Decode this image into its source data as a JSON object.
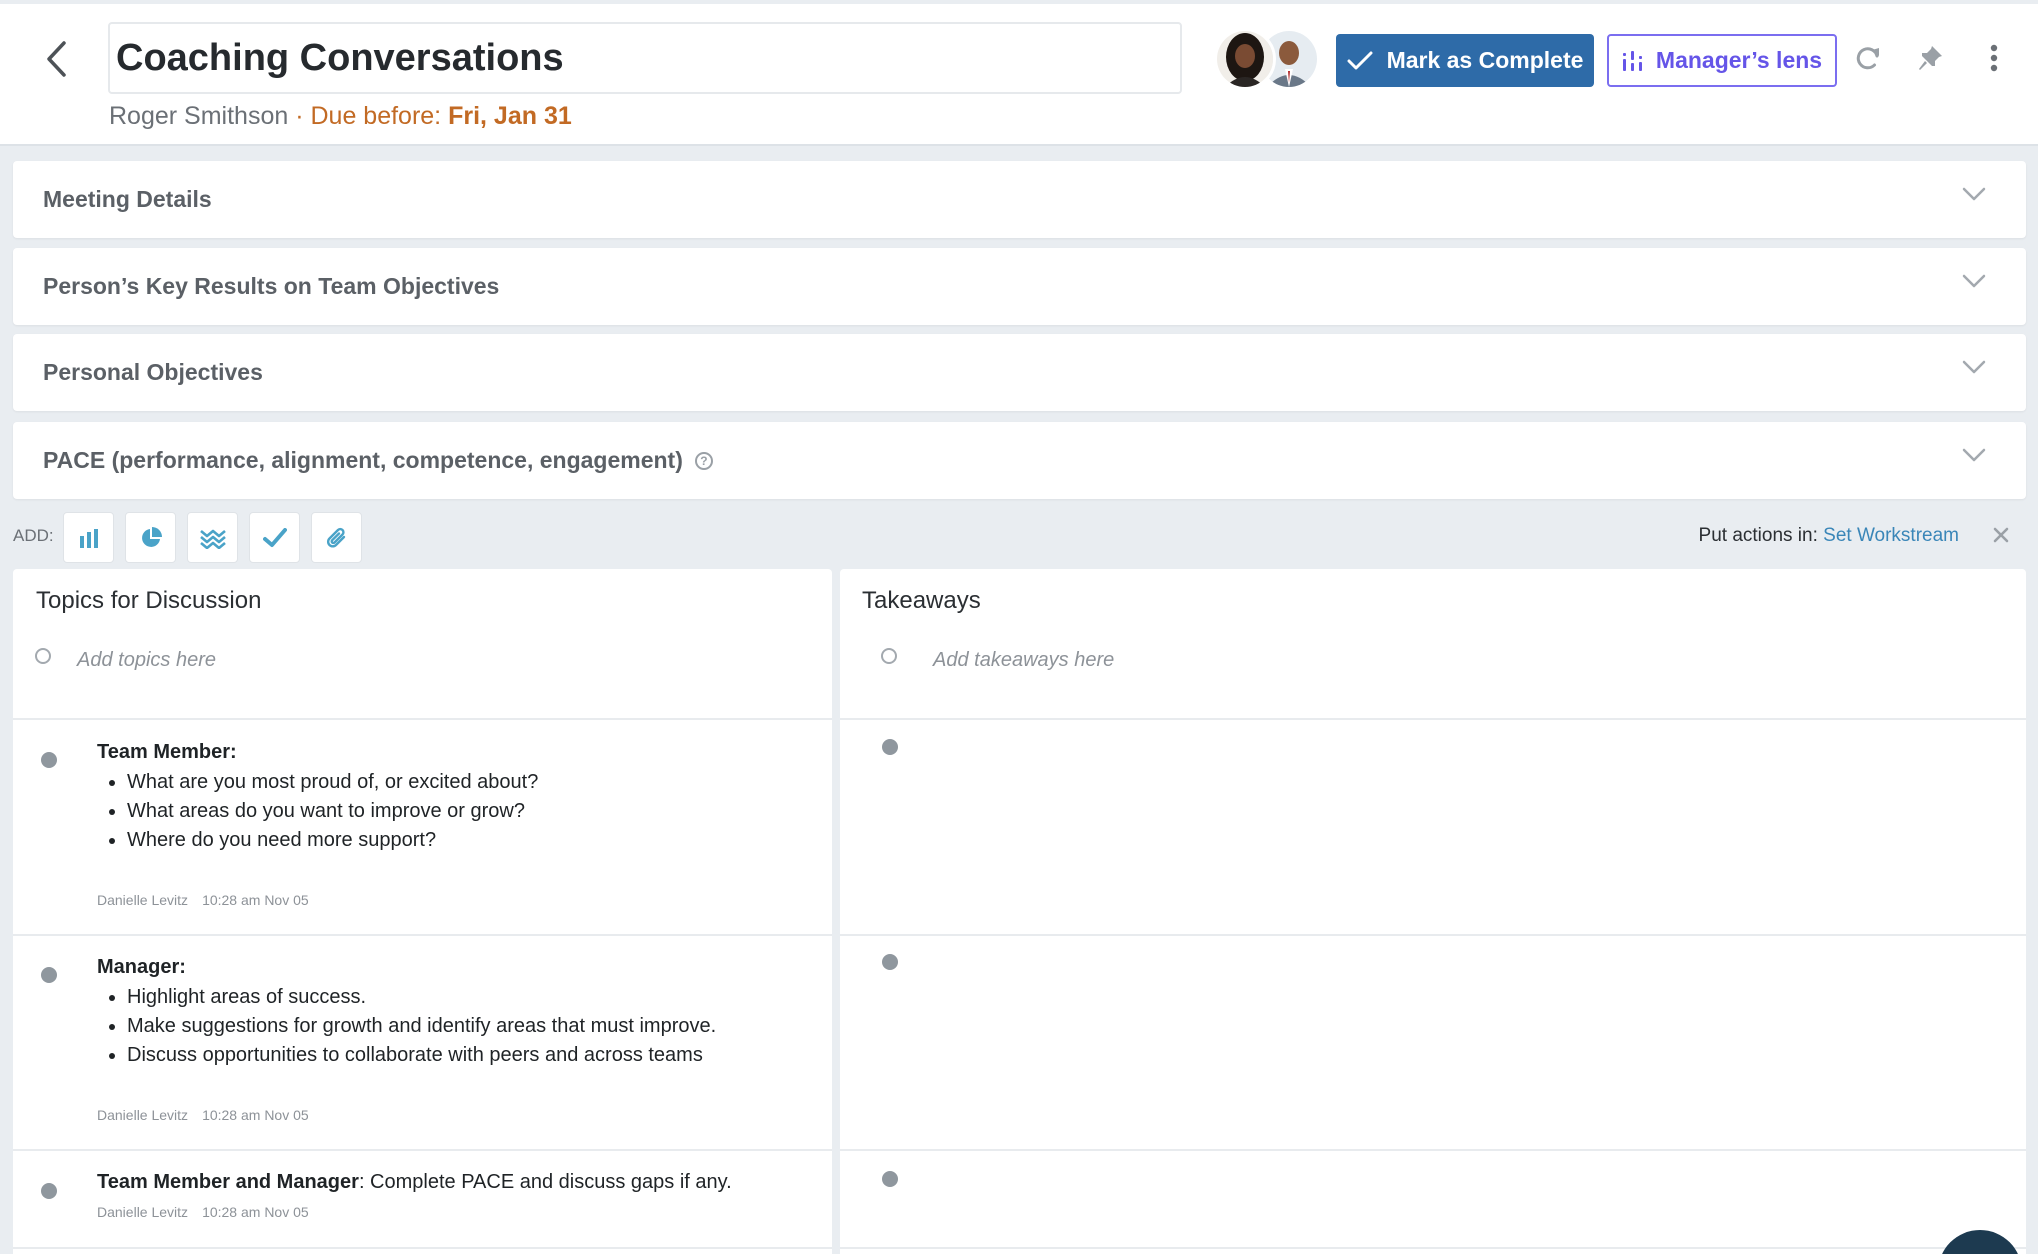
{
  "header": {
    "title": "Coaching Conversations",
    "person": "Roger Smithson",
    "separator": "·",
    "due_prefix": "Due before:",
    "due_date": "Fri, Jan 31",
    "mark_complete_label": "Mark as Complete",
    "managers_lens_label": "Manager’s lens",
    "icons": [
      "chevron-left-icon",
      "check-icon",
      "lens-bars-icon",
      "refresh-icon",
      "pin-icon",
      "kebab-menu-icon"
    ]
  },
  "sections": [
    {
      "label": "Meeting Details"
    },
    {
      "label": "Person’s Key Results on Team Objectives"
    },
    {
      "label": "Personal Objectives"
    },
    {
      "label": "PACE (performance, alignment, competence, engagement)",
      "help": "?"
    }
  ],
  "addbar": {
    "label": "ADD:",
    "buttons": [
      "bar-chart-icon",
      "pie-chart-icon",
      "waves-icon",
      "checkmark-icon",
      "paperclip-icon"
    ],
    "put_actions_label": "Put actions in:",
    "workstream_link": "Set Workstream"
  },
  "topics": {
    "heading": "Topics for Discussion",
    "placeholder": "Add topics here",
    "items": [
      {
        "head": "Team Member:",
        "bullets": [
          "What are you most proud of, or excited about?",
          "What areas do you want to improve or grow?",
          "Where do you need more support?"
        ],
        "author": "Danielle Levitz",
        "time": "10:28 am Nov 05"
      },
      {
        "head": "Manager:",
        "bullets": [
          "Highlight areas of success.",
          "Make suggestions for growth and identify areas that must improve.",
          "Discuss opportunities to collaborate with peers and across teams"
        ],
        "author": "Danielle Levitz",
        "time": "10:28 am Nov 05"
      },
      {
        "head": "Team Member and Manager",
        "text": ": Complete PACE and discuss gaps if any.",
        "author": "Danielle Levitz",
        "time": "10:28 am Nov 05"
      }
    ]
  },
  "takeaways": {
    "heading": "Takeaways",
    "placeholder": "Add takeaways here"
  },
  "colors": {
    "primary": "#2e6ba8",
    "lens": "#6555e8",
    "due": "#c26a24",
    "link": "#3a86b8",
    "icon_teal": "#4aa3c8"
  }
}
